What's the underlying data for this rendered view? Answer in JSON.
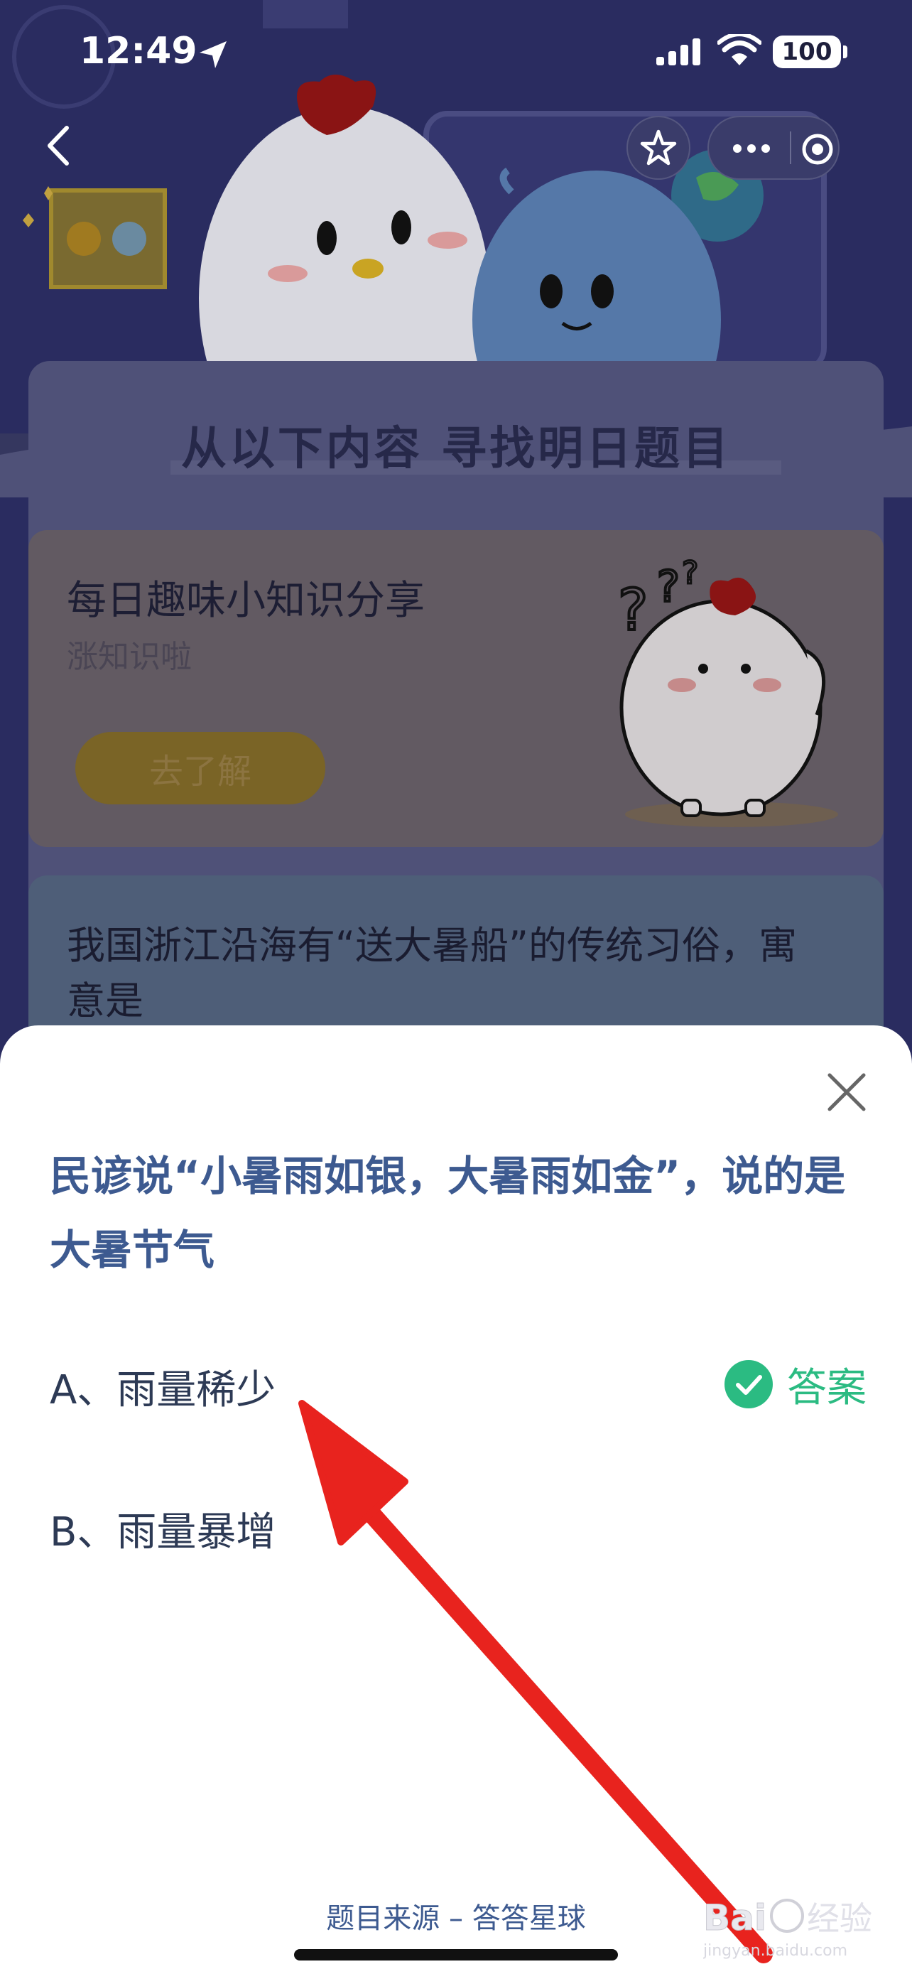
{
  "status_bar": {
    "time": "12:49",
    "battery": "100"
  },
  "page": {
    "section_title": "从以下内容  寻找明日题目",
    "trivia_card": {
      "title": "每日趣味小知识分享",
      "subtitle": "涨知识啦",
      "button_label": "去了解"
    },
    "question_card": {
      "text": "我国浙江沿海有“送大暑船”的传统习俗，寓意是"
    }
  },
  "sheet": {
    "question": "民谚说“小暑雨如银，大暑雨如金”，说的是大暑节气",
    "options": [
      {
        "label": "A、雨量稀少",
        "is_answer": true
      },
      {
        "label": "B、雨量暴增",
        "is_answer": false
      }
    ],
    "answer_label": "答案",
    "footer": "题目来源 – 答答星球"
  },
  "watermark": {
    "text": "Baidu经验",
    "sub": "jingyan.baidu.com"
  },
  "colors": {
    "accent": "#3d5a90",
    "answer_green": "#2bbb82",
    "annotation_arrow": "#e8231e"
  }
}
